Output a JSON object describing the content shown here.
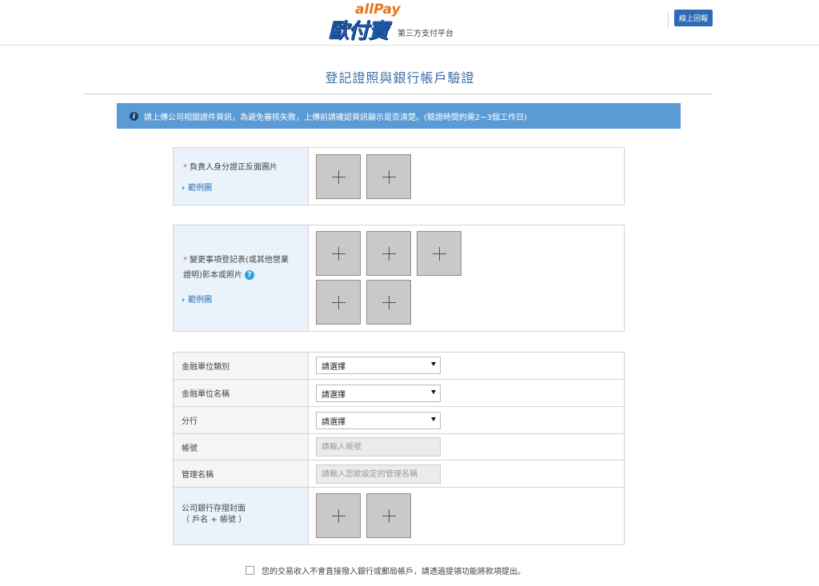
{
  "header": {
    "brand_en": "allPay",
    "brand_zh": "歐付寶",
    "brand_sub": "第三方支付平台",
    "online_button": "線上回報"
  },
  "page_title": "登記證照與銀行帳戶驗證",
  "notice": "請上傳公司相關證件資訊，為避免審核失敗，上傳前請確認資訊顯示是否清楚。(驗證時間約需2~3個工作日)",
  "section1": {
    "required_mark": "*",
    "label": "負責人身分證正反面圖片",
    "example_link": "範例圖"
  },
  "section2": {
    "required_mark": "*",
    "label_line1": "變更事項登記表(或其他營業",
    "label_line2": "證明)影本或照片",
    "help": "?",
    "example_link": "範例圖"
  },
  "form": {
    "bank_type_label": "金融單位類別",
    "bank_type_value": "請選擇",
    "bank_name_label": "金融單位名稱",
    "bank_name_value": "請選擇",
    "branch_label": "分行",
    "branch_value": "請選擇",
    "account_label": "帳號",
    "account_placeholder": "請輸入帳號",
    "manage_name_label": "管理名稱",
    "manage_name_placeholder": "請輸入您欲設定的管理名稱",
    "passbook_label_line1": "公司銀行存摺封面",
    "passbook_label_line2": "（ 戶名 + 帳號 ）"
  },
  "consent": "您的交易收入不會直接撥入銀行或郵局帳戶，請透過提領功能將款項提出。",
  "colors": {
    "notice_bg": "#5b9bd5",
    "brand_blue": "#1f5aa6",
    "brand_orange": "#e8751a",
    "label_bg": "#eaf3fc"
  }
}
